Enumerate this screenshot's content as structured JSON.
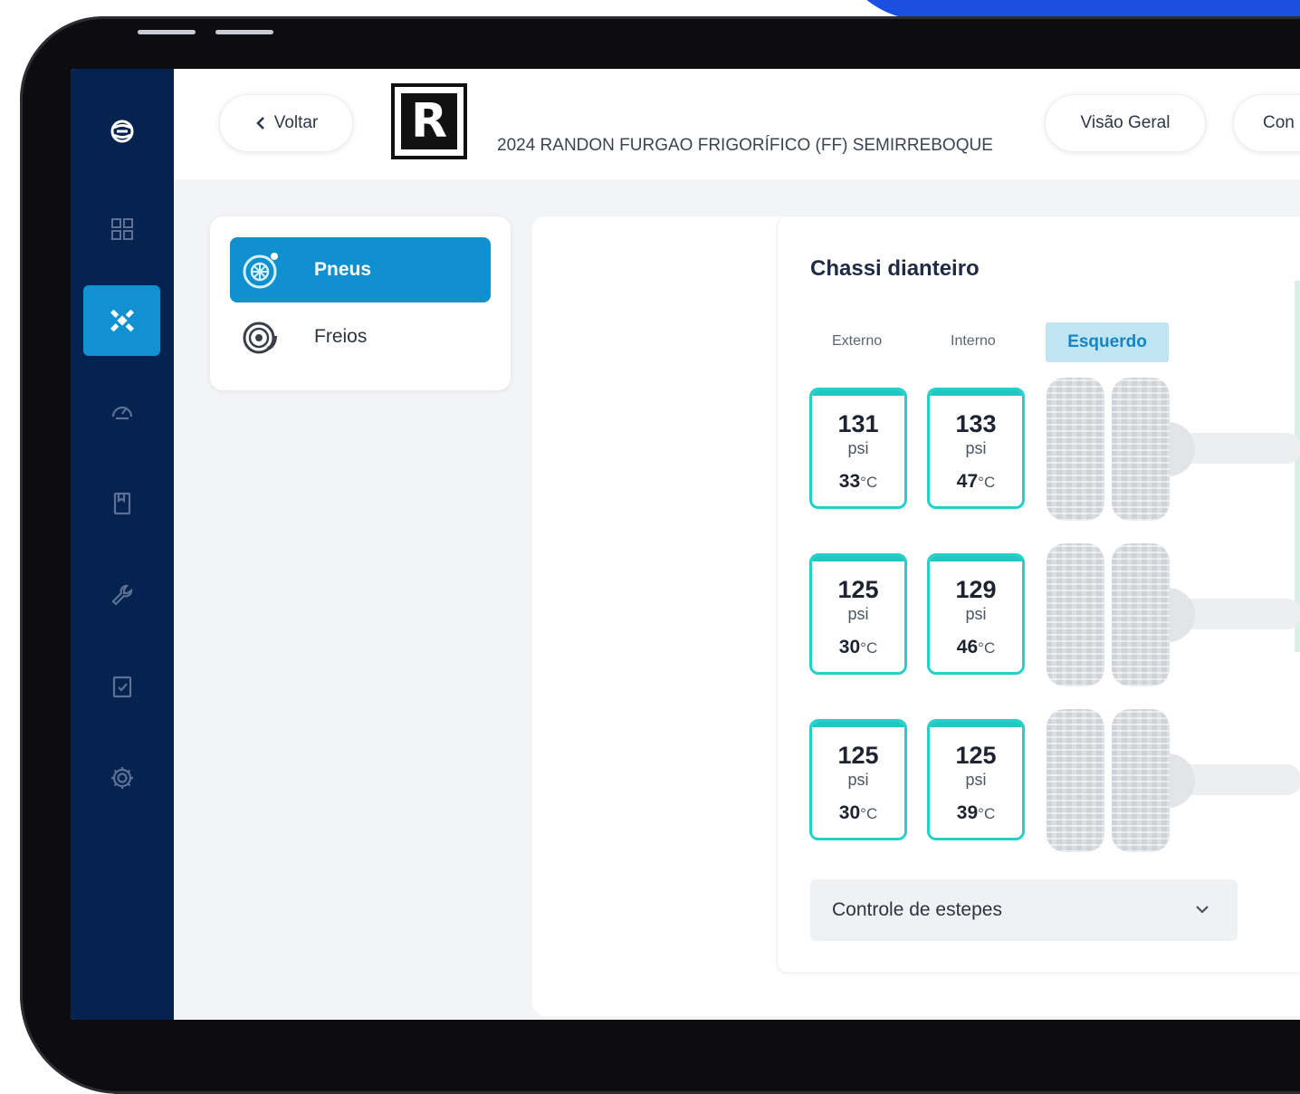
{
  "header": {
    "back_label": "Voltar",
    "logo_letter": "R",
    "vehicle_title": "2024 RANDON FURGAO FRIGORÍFICO (FF) SEMIRREBOQUE",
    "tabs": [
      {
        "label": "Visão Geral"
      },
      {
        "label": "Con"
      }
    ]
  },
  "sidebar": {
    "items": [
      {
        "icon": "brand-logo-icon"
      },
      {
        "icon": "grid-icon"
      },
      {
        "icon": "satellite-icon",
        "active": true
      },
      {
        "icon": "gauge-icon"
      },
      {
        "icon": "document-icon"
      },
      {
        "icon": "wrench-icon"
      },
      {
        "icon": "clipboard-check-icon"
      },
      {
        "icon": "gear-icon"
      }
    ]
  },
  "menu": {
    "items": [
      {
        "label": "Pneus",
        "icon": "tire-icon",
        "active": true
      },
      {
        "label": "Freios",
        "icon": "brake-icon"
      }
    ]
  },
  "chassis": {
    "title": "Chassi dianteiro",
    "col_external": "Externo",
    "col_internal": "Interno",
    "side_label": "Esquerdo",
    "pressure_unit": "psi",
    "temp_unit": "°C",
    "axles": [
      {
        "external": {
          "psi": "131",
          "temp": "33"
        },
        "internal": {
          "psi": "133",
          "temp": "47"
        }
      },
      {
        "external": {
          "psi": "125",
          "temp": "30"
        },
        "internal": {
          "psi": "129",
          "temp": "46"
        }
      },
      {
        "external": {
          "psi": "125",
          "temp": "30"
        },
        "internal": {
          "psi": "125",
          "temp": "39"
        }
      }
    ],
    "accent_color": "#23d1cb"
  },
  "spare_control": {
    "label": "Controle de estepes"
  },
  "colors": {
    "sidebar_bg": "#06224e",
    "active_blue": "#1090cf",
    "badge_bg": "#bfe5f2"
  }
}
